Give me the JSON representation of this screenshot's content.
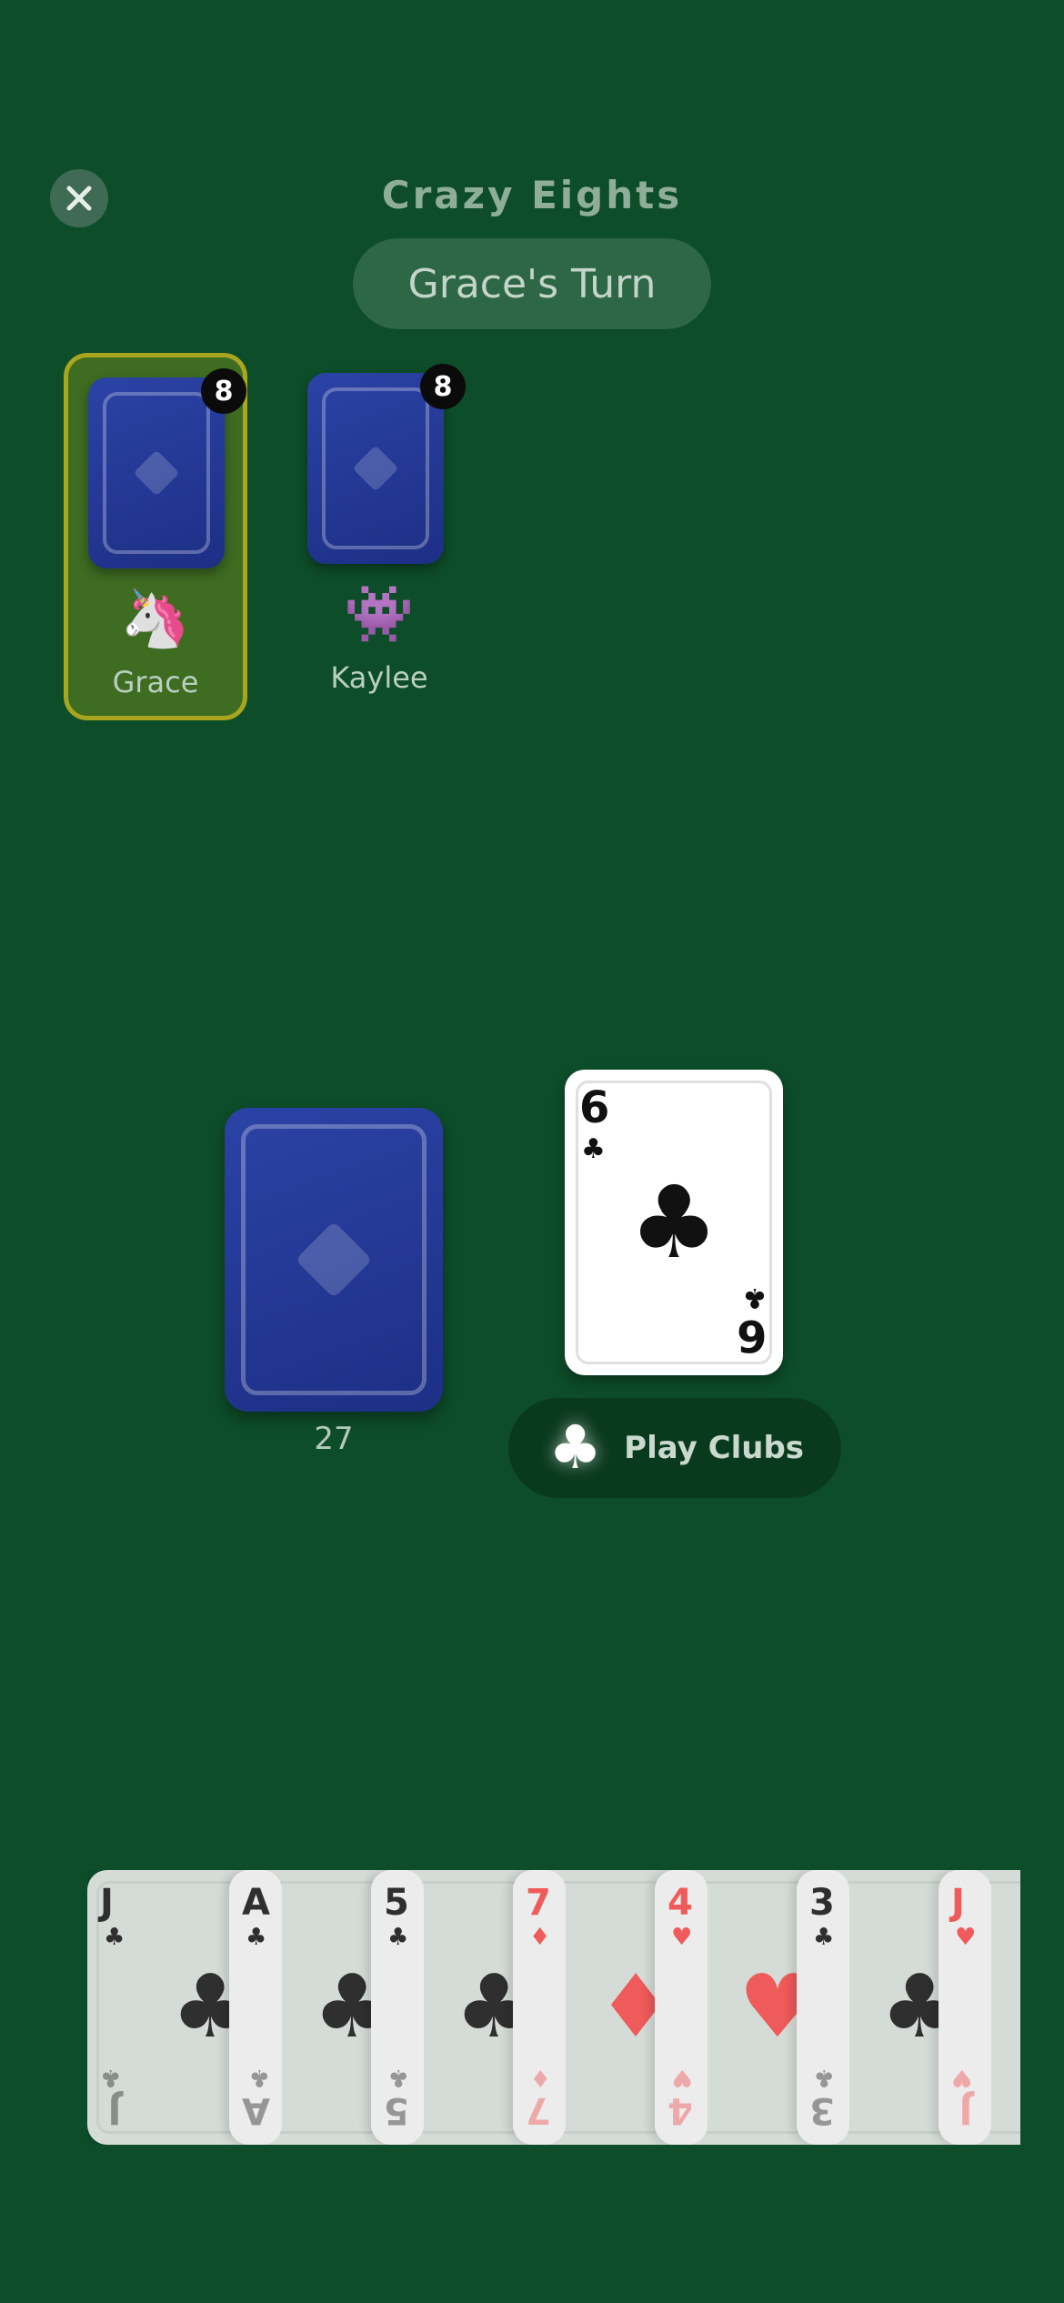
{
  "header": {
    "title": "Crazy Eights",
    "turn": "Grace's Turn",
    "close_icon": "close-icon"
  },
  "players": [
    {
      "name": "Grace",
      "avatar": "🦄",
      "card_count": "8",
      "active": true
    },
    {
      "name": "Kaylee",
      "avatar": "👾",
      "card_count": "8",
      "active": false
    }
  ],
  "deck": {
    "count": "27"
  },
  "discard": {
    "rank": "6",
    "suit": "♣",
    "color": "black"
  },
  "play_button": {
    "suit_icon": "♣",
    "label": "Play Clubs"
  },
  "hand": [
    {
      "rank": "J",
      "suit": "♣",
      "color": "black"
    },
    {
      "rank": "A",
      "suit": "♣",
      "color": "black"
    },
    {
      "rank": "5",
      "suit": "♣",
      "color": "black"
    },
    {
      "rank": "7",
      "suit": "♦",
      "color": "red"
    },
    {
      "rank": "4",
      "suit": "♥",
      "color": "red"
    },
    {
      "rank": "3",
      "suit": "♣",
      "color": "black"
    },
    {
      "rank": "J",
      "suit": "♥",
      "color": "red"
    }
  ],
  "colors": {
    "background": "#0d4d29",
    "active_border": "#a8a51e",
    "card_back": "#2b43a6"
  }
}
